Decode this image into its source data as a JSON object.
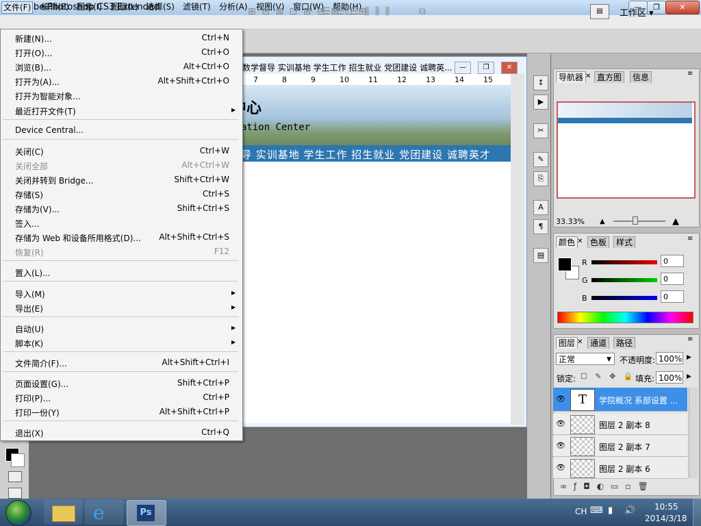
{
  "app": {
    "title": "Adobe Photoshop CS3 Extended",
    "logo": "Ps"
  },
  "window_buttons": {
    "minimize": "—",
    "maximize": "❐",
    "close": "✕"
  },
  "menubar": [
    "文件(F)",
    "编辑(E)",
    "图像(I)",
    "图层(L)",
    "选择(S)",
    "滤镜(T)",
    "分析(A)",
    "视图(V)",
    "窗口(W)",
    "帮助(H)"
  ],
  "optionsbar": {
    "workspace": "工作区 ▾"
  },
  "file_menu": [
    {
      "label": "新建(N)...",
      "shortcut": "Ctrl+N"
    },
    {
      "label": "打开(O)...",
      "shortcut": "Ctrl+O"
    },
    {
      "label": "浏览(B)...",
      "shortcut": "Alt+Ctrl+O"
    },
    {
      "label": "打开为(A)...",
      "shortcut": "Alt+Shift+Ctrl+O"
    },
    {
      "label": "打开为智能对象..."
    },
    {
      "label": "最近打开文件(T)",
      "submenu": true
    },
    {
      "label": "Device Central..."
    },
    {
      "label": "关闭(C)",
      "shortcut": "Ctrl+W"
    },
    {
      "label": "关闭全部",
      "shortcut": "Alt+Ctrl+W",
      "disabled": true
    },
    {
      "label": "关闭并转到 Bridge...",
      "shortcut": "Shift+Ctrl+W"
    },
    {
      "label": "存储(S)",
      "shortcut": "Ctrl+S"
    },
    {
      "label": "存储为(V)...",
      "shortcut": "Shift+Ctrl+S"
    },
    {
      "label": "签入..."
    },
    {
      "label": "存储为 Web 和设备所用格式(D)...",
      "shortcut": "Alt+Shift+Ctrl+S"
    },
    {
      "label": "恢复(R)",
      "shortcut": "F12",
      "disabled": true
    },
    {
      "label": "置入(L)..."
    },
    {
      "label": "导入(M)",
      "submenu": true
    },
    {
      "label": "导出(E)",
      "submenu": true
    },
    {
      "label": "自动(U)",
      "submenu": true
    },
    {
      "label": "脚本(K)",
      "submenu": true
    },
    {
      "label": "文件简介(F)...",
      "shortcut": "Alt+Shift+Ctrl+I"
    },
    {
      "label": "页面设置(G)...",
      "shortcut": "Shift+Ctrl+P"
    },
    {
      "label": "打印(P)...",
      "shortcut": "Ctrl+P"
    },
    {
      "label": "打印一份(Y)",
      "shortcut": "Alt+Shift+Ctrl+P"
    },
    {
      "label": "退出(X)",
      "shortcut": "Ctrl+Q"
    }
  ],
  "document": {
    "title": "数学督导 实训基地 学生工作 招生就业 党团建设 诚聘英...",
    "ruler": [
      "7",
      "8",
      "9",
      "10",
      "11",
      "12",
      "13",
      "14",
      "15"
    ],
    "banner_cn": "中心",
    "banner_en": "ation Center",
    "nav": "导 实训基地 学生工作 招生就业 党团建设 诚聘英才"
  },
  "navigator": {
    "tabs": [
      "导航器",
      "直方图",
      "信息"
    ],
    "zoom": "33.33%"
  },
  "color": {
    "tabs": [
      "颜色",
      "色板",
      "样式"
    ],
    "r": "0",
    "g": "0",
    "b": "0",
    "r_label": "R",
    "g_label": "G",
    "b_label": "B"
  },
  "layers": {
    "tabs": [
      "图层",
      "通道",
      "路径"
    ],
    "mode": "正常",
    "opacity_label": "不透明度:",
    "opacity": "100%",
    "lock_label": "锁定:",
    "fill_label": "填充:",
    "fill": "100%",
    "items": [
      {
        "name": "学院概况 系部设置 ...",
        "type": "text",
        "selected": true
      },
      {
        "name": "图层 2 副本 8"
      },
      {
        "name": "图层 2 副本 7"
      },
      {
        "name": "图层 2 副本 6"
      }
    ]
  },
  "taskbar": {
    "lang": "CH",
    "time": "10:55",
    "date": "2014/3/18",
    "ps_label": "Ps"
  }
}
